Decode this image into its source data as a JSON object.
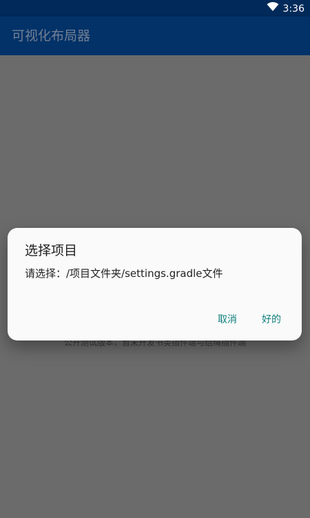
{
  "status_bar": {
    "time": "3:36",
    "icons": [
      "wifi-icon"
    ]
  },
  "app_bar": {
    "title": "可视化布局器"
  },
  "background": {
    "notice": "公开测试版本，暂未开发书类插件端与结绳插件端"
  },
  "dialog": {
    "title": "选择项目",
    "message": "请选择：/项目文件夹/settings.gradle文件",
    "cancel_label": "取消",
    "ok_label": "好的"
  },
  "colors": {
    "status_bar": "#012a5a",
    "app_bar": "#023268",
    "scrim_background": "#6b6b6b",
    "dialog_background": "#fafafa",
    "accent": "#0f7f7b"
  }
}
